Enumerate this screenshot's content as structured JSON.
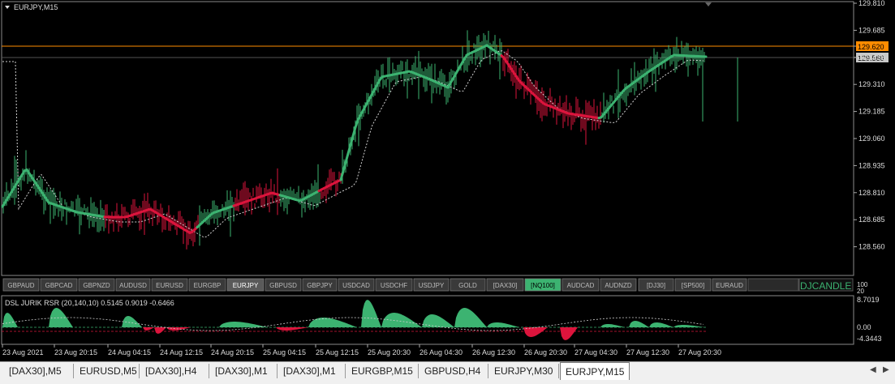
{
  "chart": {
    "title": "EURJPY,M15",
    "price_labels": [
      "129.810",
      "129.685",
      "129.620",
      "129.560",
      "129.435",
      "129.310",
      "129.185",
      "129.060",
      "128.935",
      "128.810",
      "128.685",
      "128.560"
    ],
    "marker_orange": "129.620",
    "marker_gray": "129.560",
    "colors": {
      "bull": "#3cb371",
      "bear": "#dc143c",
      "orange": "#ff8c00",
      "grid_gray": "#777777",
      "bg": "#000000"
    }
  },
  "symbol_buttons": [
    "GBPAUD",
    "GBPCAD",
    "GBPNZD",
    "AUDUSD",
    "EURUSD",
    "EURGBP",
    "EURJPY",
    "GBPUSD",
    "GBPJPY",
    "USDCAD",
    "USDCHF",
    "USDJPY",
    "GOLD",
    "[DAX30]",
    "[NQ100]",
    "AUDCAD",
    "AUDNZD",
    "[DJ30]",
    "[SP500]",
    "EURAUD"
  ],
  "symbol_active": "EURJPY",
  "symbol_highlight": "[NQ100]",
  "brand": "DJCANDLE",
  "main_scale": {
    "top": "100",
    "bottom": "20"
  },
  "indicator": {
    "title": "DSL JURIK RSR (20,140,10) 0.5145 0.9019 -0.6466",
    "labels": [
      "8.7019",
      "0.00",
      "-4.3443"
    ]
  },
  "time_labels": [
    "23 Aug 2021",
    "23 Aug 20:15",
    "24 Aug 04:15",
    "24 Aug 12:15",
    "24 Aug 20:15",
    "25 Aug 04:15",
    "25 Aug 12:15",
    "25 Aug 20:30",
    "26 Aug 04:30",
    "26 Aug 12:30",
    "26 Aug 20:30",
    "27 Aug 04:30",
    "27 Aug 12:30",
    "27 Aug 20:30"
  ],
  "tabs": [
    "[DAX30],M5",
    "EURUSD,M5",
    "[DAX30],H4",
    "[DAX30],M1",
    "[DAX30],M1",
    "EURGBP,M15",
    "GBPUSD,H4",
    "EURJPY,M30",
    "EURJPY,M15"
  ],
  "active_tab": "EURJPY,M15"
}
